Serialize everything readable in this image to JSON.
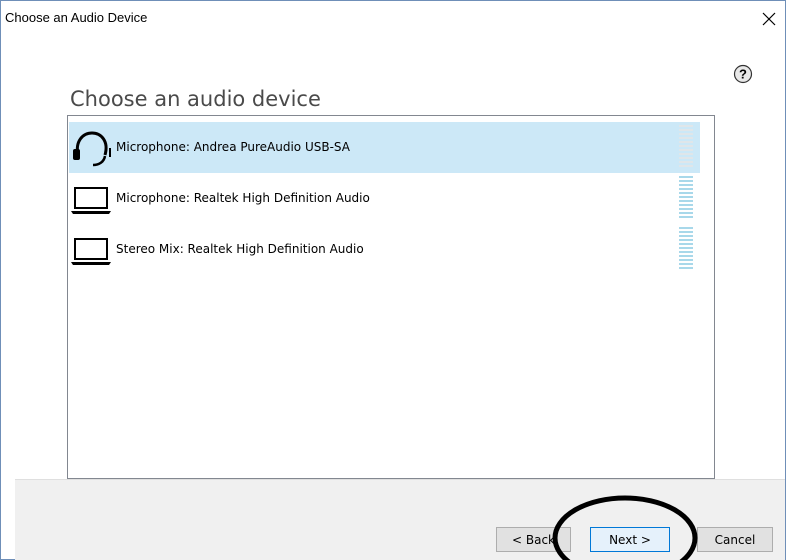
{
  "window": {
    "title": "Choose an Audio Device",
    "close_glyph": "✕"
  },
  "main": {
    "heading": "Choose an audio device",
    "help_glyph": "?"
  },
  "devices": [
    {
      "label": "Microphone: Andrea PureAudio USB-SA",
      "icon": "headset-icon",
      "selected": true
    },
    {
      "label": "Microphone: Realtek High Definition Audio",
      "icon": "laptop-icon",
      "selected": false
    },
    {
      "label": "Stereo Mix: Realtek High Definition Audio",
      "icon": "laptop-icon",
      "selected": false
    }
  ],
  "footer": {
    "back_label": "< Back",
    "next_label": "Next >",
    "cancel_label": "Cancel"
  },
  "colors": {
    "selection": "#cce8f7",
    "meter": "#a8d8ea",
    "annotation": "#000000"
  }
}
